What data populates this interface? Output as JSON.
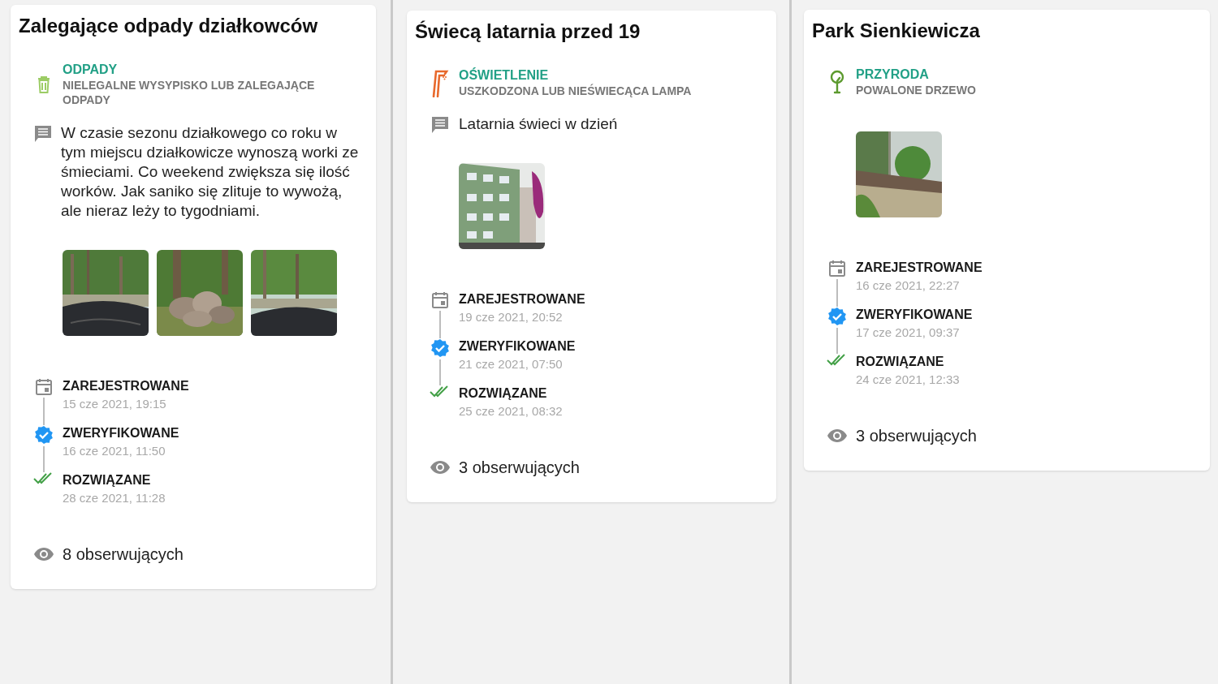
{
  "panels": [
    {
      "title": "Zalegające odpady działkowców",
      "category": {
        "kind": "waste",
        "name": "ODPADY",
        "subcategory": "NIELEGALNE WYSYPISKO LUB ZALEGAJĄCE ODPADY"
      },
      "description": "W czasie sezonu działkowego co roku w tym miejscu działkowicze wynoszą worki ze śmieciami. Co weekend zwiększa się ilość worków. Jak saniko się zlituje to wywożą, ale nieraz leży to tygodniami.",
      "timeline": [
        {
          "kind": "registered",
          "label": "ZAREJESTROWANE",
          "date": "15 cze 2021, 19:15"
        },
        {
          "kind": "verified",
          "label": "ZWERYFIKOWANE",
          "date": "16 cze 2021, 11:50"
        },
        {
          "kind": "resolved",
          "label": "ROZWIĄZANE",
          "date": "28 cze 2021, 11:28"
        }
      ],
      "followers": "8 obserwujących"
    },
    {
      "title": "Świecą latarnia przed 19",
      "category": {
        "kind": "lighting",
        "name": "OŚWIETLENIE",
        "subcategory": "USZKODZONA LUB NIEŚWIECĄCA LAMPA"
      },
      "description": "Latarnia świeci w dzień",
      "timeline": [
        {
          "kind": "registered",
          "label": "ZAREJESTROWANE",
          "date": "19 cze 2021, 20:52"
        },
        {
          "kind": "verified",
          "label": "ZWERYFIKOWANE",
          "date": "21 cze 2021, 07:50"
        },
        {
          "kind": "resolved",
          "label": "ROZWIĄZANE",
          "date": "25 cze 2021, 08:32"
        }
      ],
      "followers": "3 obserwujących"
    },
    {
      "title": "Park Sienkiewicza",
      "category": {
        "kind": "nature",
        "name": "PRZYRODA",
        "subcategory": "POWALONE DRZEWO"
      },
      "timeline": [
        {
          "kind": "registered",
          "label": "ZAREJESTROWANE",
          "date": "16 cze 2021, 22:27"
        },
        {
          "kind": "verified",
          "label": "ZWERYFIKOWANE",
          "date": "17 cze 2021, 09:37"
        },
        {
          "kind": "resolved",
          "label": "ROZWIĄZANE",
          "date": "24 cze 2021, 12:33"
        }
      ],
      "followers": "3 obserwujących"
    }
  ]
}
